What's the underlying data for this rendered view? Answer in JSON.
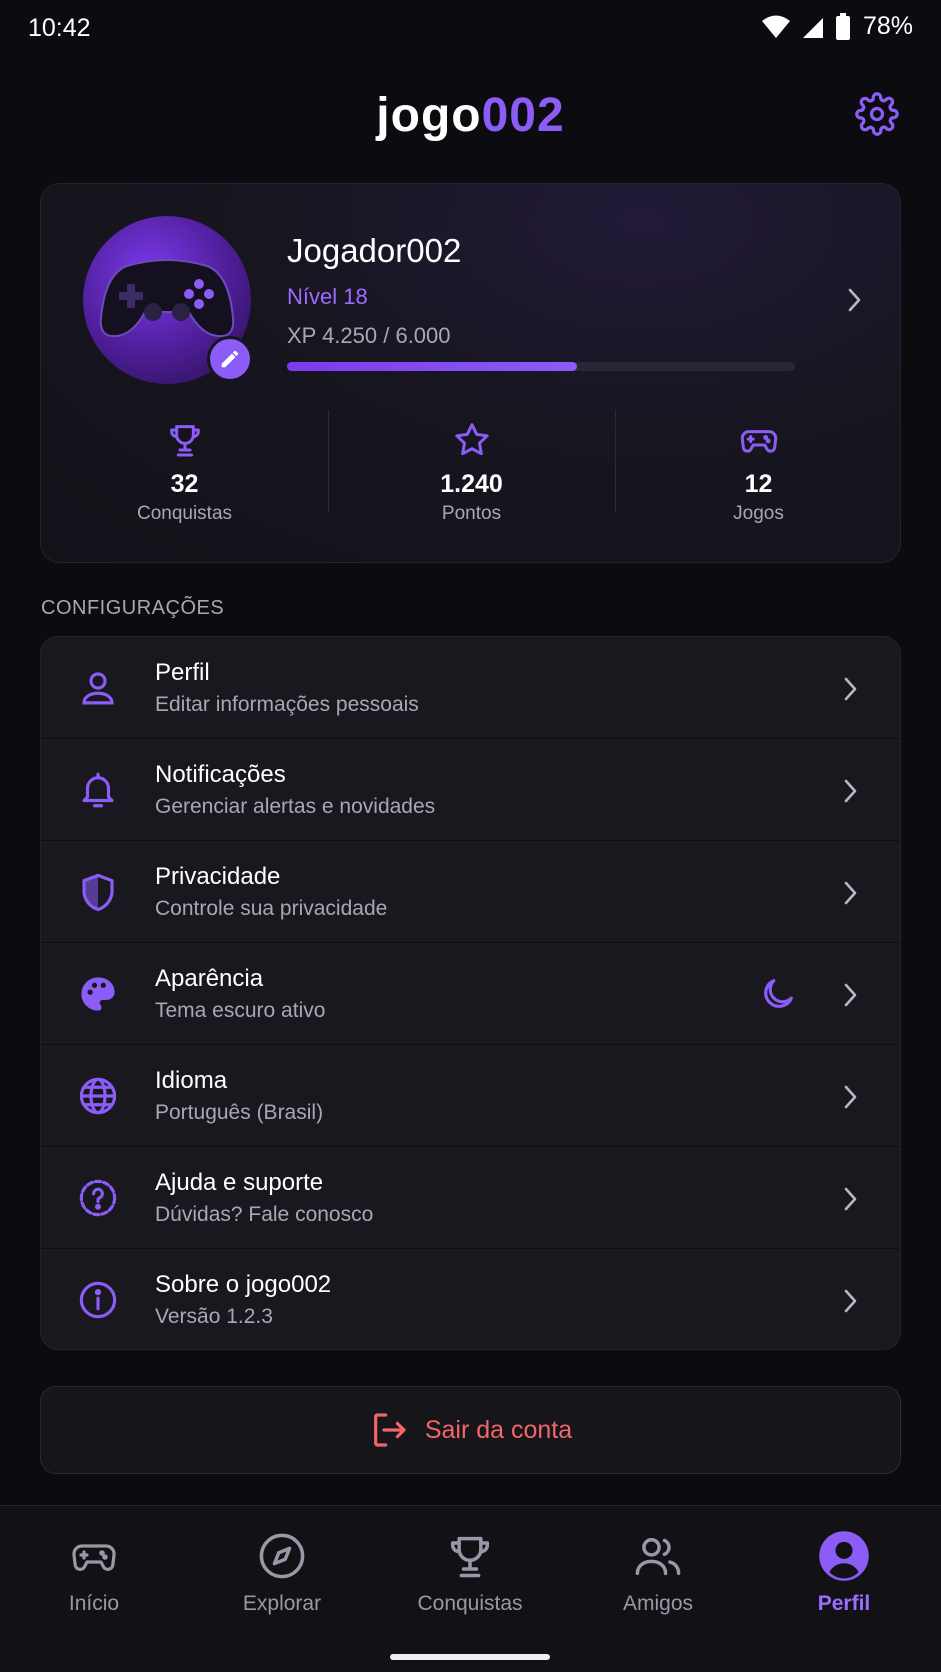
{
  "status_bar": {
    "time": "10:42",
    "battery": "78%"
  },
  "header": {
    "logo_part1": "jogo",
    "logo_part2": "002",
    "settings_icon": "gear-icon"
  },
  "profile": {
    "name": "Jogador002",
    "level": "Nível 18",
    "xp": "XP 4.250 / 6.000",
    "xp_progress": 0.57,
    "avatar_icon": "gamepad-icon",
    "edit_icon": "pencil-icon"
  },
  "stats": [
    {
      "icon": "trophy-icon",
      "value": "32",
      "label": "Conquistas"
    },
    {
      "icon": "star-icon",
      "value": "1.240",
      "label": "Pontos"
    },
    {
      "icon": "gamepad-icon",
      "value": "12",
      "label": "Jogos"
    }
  ],
  "settings": {
    "section_title": "CONFIGURAÇÕES",
    "items": [
      {
        "icon": "user-icon",
        "title": "Perfil",
        "subtitle": "Editar informações pessoais"
      },
      {
        "icon": "bell-icon",
        "title": "Notificações",
        "subtitle": "Gerenciar alertas e novidades"
      },
      {
        "icon": "shield-icon",
        "title": "Privacidade",
        "subtitle": "Controle sua privacidade"
      },
      {
        "icon": "palette-icon",
        "title": "Aparência",
        "subtitle": "Tema escuro ativo",
        "extra_icon": "moon-icon"
      },
      {
        "icon": "globe-icon",
        "title": "Idioma",
        "subtitle": "Português (Brasil)"
      },
      {
        "icon": "help-icon",
        "title": "Ajuda e suporte",
        "subtitle": "Dúvidas? Fale conosco"
      },
      {
        "icon": "info-icon",
        "title": "Sobre o jogo002",
        "subtitle": "Versão 1.2.3"
      }
    ]
  },
  "logout": {
    "label": "Sair da conta",
    "icon": "logout-icon"
  },
  "nav": {
    "items": [
      {
        "label": "Início",
        "icon": "gamepad-icon"
      },
      {
        "label": "Explorar",
        "icon": "compass-icon"
      },
      {
        "label": "Conquistas",
        "icon": "trophy-icon"
      },
      {
        "label": "Amigos",
        "icon": "users-icon"
      },
      {
        "label": "Perfil",
        "icon": "profile-icon"
      }
    ],
    "active": "Perfil"
  },
  "colors": {
    "accent": "#8b5cf6",
    "danger": "#f2666a",
    "background": "#0c0c10"
  }
}
